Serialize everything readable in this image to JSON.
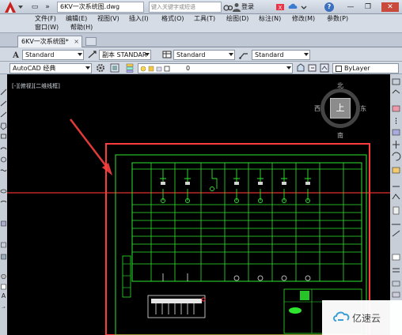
{
  "titlebar": {
    "doc_title": "6KV一次系统图.dwg",
    "search_placeholder": "键入关键字或短语",
    "login": "登录",
    "help": "?"
  },
  "menu": {
    "row1": [
      "文件(F)",
      "编辑(E)",
      "视图(V)",
      "插入(I)",
      "格式(O)",
      "工具(T)",
      "绘图(D)",
      "标注(N)",
      "修改(M)",
      "参数(P)"
    ],
    "row2": [
      "窗口(W)",
      "帮助(H)"
    ]
  },
  "tabs": {
    "active": "6KV一次系统图*",
    "close": "×"
  },
  "toolbar_styles": {
    "text_style": "Standard",
    "dim_style": "副本 STANDAR",
    "table_style": "Standard",
    "mleader_style": "Standard"
  },
  "toolbar_layers": {
    "workspace": "AutoCAD 经典",
    "layer": "0",
    "color": "ByLayer"
  },
  "viewport": {
    "label": "[-][俯视][二维线框]"
  },
  "viewcube": {
    "top": "上",
    "north": "北",
    "south": "南",
    "east": "东",
    "west": "西"
  },
  "watermark": {
    "text": "亿速云"
  },
  "colors": {
    "drawing_frame": "#ff3c3c",
    "drawing_lines": "#2ee62e",
    "canvas": "#000000",
    "chrome": "#d2d9e3"
  }
}
